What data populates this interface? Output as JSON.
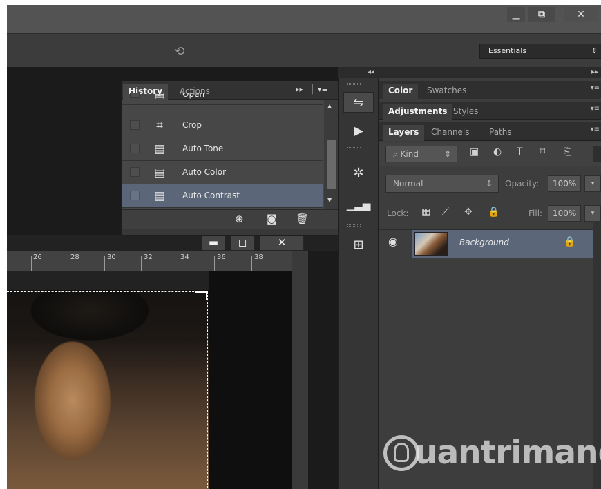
{
  "window": {
    "minimize_icon": "minimize-icon",
    "restore_icon": "restore-icon",
    "close_glyph": "✕"
  },
  "options_bar": {
    "undo_icon": "rotate-icon",
    "workspace": "Essentials"
  },
  "history_panel": {
    "tabs": [
      "History",
      "Actions"
    ],
    "active_tab": "History",
    "items": [
      {
        "label": "Open",
        "icon": "document-icon",
        "selected": false
      },
      {
        "label": "Crop",
        "icon": "crop-icon",
        "selected": false
      },
      {
        "label": "Auto Tone",
        "icon": "document-icon",
        "selected": false
      },
      {
        "label": "Auto Color",
        "icon": "document-icon",
        "selected": false
      },
      {
        "label": "Auto Contrast",
        "icon": "document-icon",
        "selected": true
      }
    ],
    "footer_icons": [
      "new-document-from-state-icon",
      "camera-icon",
      "trash-icon"
    ]
  },
  "document": {
    "ruler_ticks": [
      "26",
      "28",
      "30",
      "32",
      "34",
      "36",
      "38"
    ],
    "buttons": [
      "minimize-icon",
      "maximize-icon",
      "close-icon"
    ]
  },
  "icon_strip": [
    "history-icon",
    "play-icon",
    "adjustment-brush-icon",
    "histogram-icon",
    "properties-icon"
  ],
  "right_panels": {
    "group1_tabs": [
      "Color",
      "Swatches"
    ],
    "group2_tabs": [
      "Adjustments",
      "Styles"
    ],
    "group3_tabs": [
      "Layers",
      "Channels",
      "Paths"
    ],
    "kind_label": "Kind",
    "blend_mode": "Normal",
    "opacity_label": "Opacity:",
    "opacity_value": "100%",
    "lock_label": "Lock:",
    "fill_label": "Fill:",
    "fill_value": "100%",
    "layers": [
      {
        "name": "Background",
        "visible": true,
        "locked": true
      }
    ]
  },
  "watermark": {
    "text": "uantrimang"
  },
  "colors": {
    "selection": "#5b6679",
    "panel": "#474747",
    "dark_bg": "#1b1b1b"
  }
}
